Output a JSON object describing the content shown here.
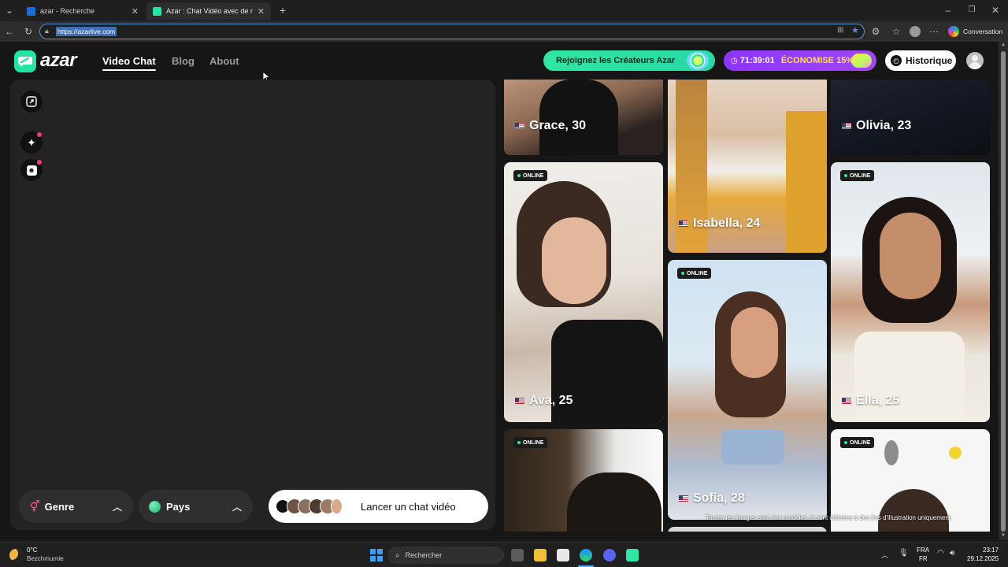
{
  "browser": {
    "tabs": [
      {
        "title": "azar - Recherche",
        "active": false
      },
      {
        "title": "Azar : Chat Vidéo avec de nouvelle",
        "active": true
      }
    ],
    "new_tab_label": "+",
    "url": "https://azarlive.com",
    "profile_label": "Conversation"
  },
  "site": {
    "brand": "azar",
    "nav": [
      {
        "label": "Video Chat",
        "active": true
      },
      {
        "label": "Blog",
        "active": false
      },
      {
        "label": "About",
        "active": false
      }
    ],
    "creators_button": "Rejoignez les Créateurs Azar",
    "promo": {
      "timer": "71:39:01",
      "text": "ÉCONOMISE 15%"
    },
    "history_button": "Historique"
  },
  "chat_panel": {
    "gender_label": "Genre",
    "country_label": "Pays",
    "start_button": "Lancer un chat vidéo"
  },
  "cards": [
    {
      "name": "Grace, 30",
      "online": false
    },
    {
      "name": "Isabella, 24",
      "online": false
    },
    {
      "name": "Olivia, 23",
      "online": false
    },
    {
      "name": "Ava, 25",
      "online": true
    },
    {
      "name": "Sofia, 28",
      "online": true
    },
    {
      "name": "Ella, 25",
      "online": true
    },
    {
      "name": "",
      "online": true
    },
    {
      "name": "",
      "online": true
    }
  ],
  "online_badge": "ONLINE",
  "disclaimer": "Toutes les images sont des modèles et sont utilisées à des fins d'illustration uniquement.",
  "taskbar": {
    "weather_temp": "0°C",
    "weather_desc": "Bezchmurnie",
    "search_placeholder": "Rechercher",
    "lang": "FRA",
    "lang_sub": "FR",
    "time": "23:17",
    "date": "29.12.2025"
  },
  "colors": {
    "accent_green": "#2fe6a3",
    "accent_purple": "#9b40f7",
    "bg": "#161616"
  }
}
